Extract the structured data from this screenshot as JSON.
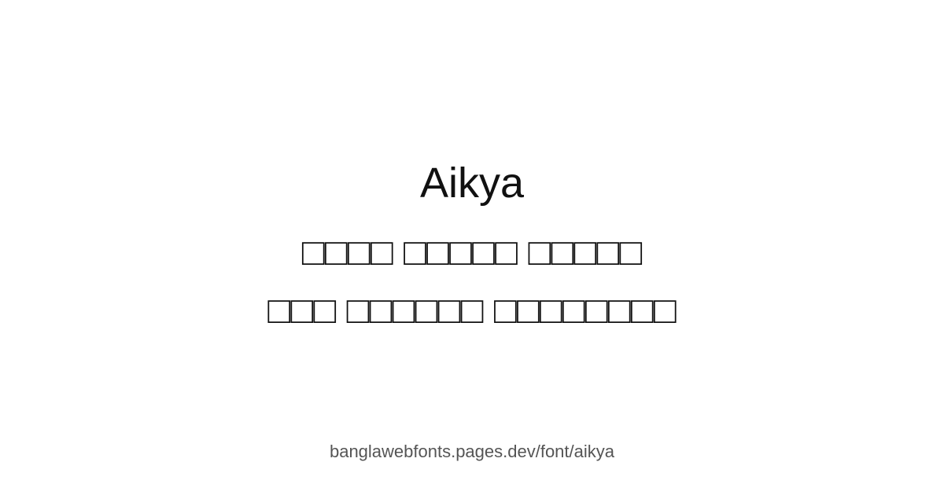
{
  "card": {
    "title": "Aikya",
    "sample_lines": [
      "□□□□ □□□□□ □□□□□",
      "□□□ □□□□□□ □□□□□□□□"
    ],
    "url": "banglawebfonts.pages.dev/font/aikya"
  },
  "colors": {
    "background": "#ffffff",
    "title_text": "#111111",
    "sample_text": "#111111",
    "url_text": "#555555"
  }
}
